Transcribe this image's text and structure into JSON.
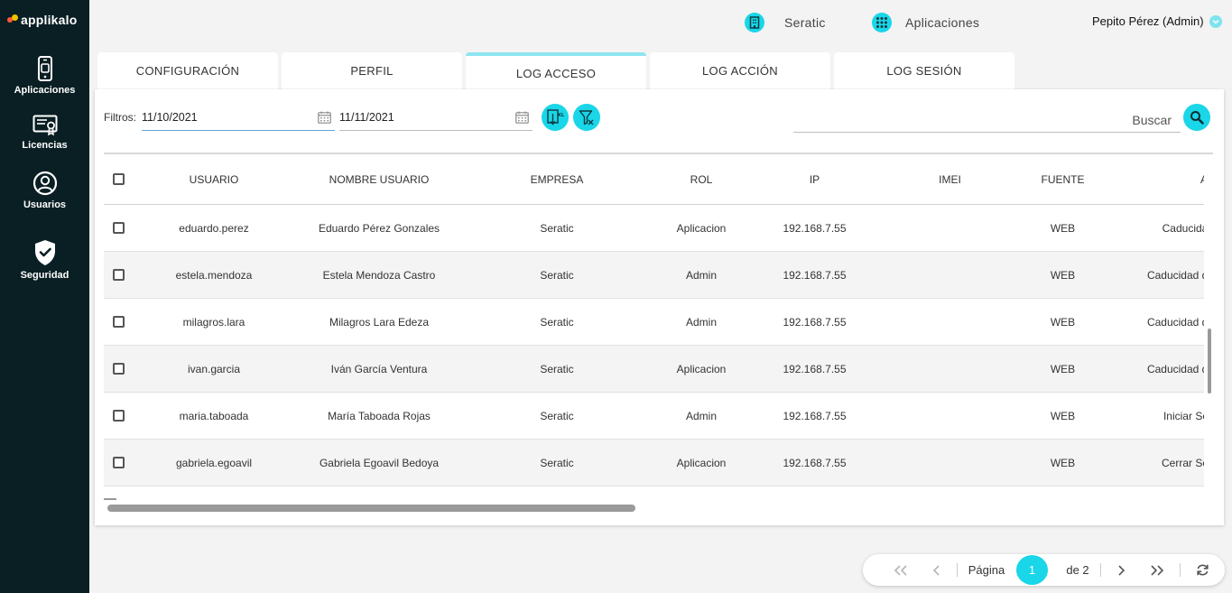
{
  "brand": {
    "name": "applikalo"
  },
  "sidebar": {
    "items": [
      {
        "label": "Aplicaciones",
        "icon": "smartphone-icon"
      },
      {
        "label": "Licencias",
        "icon": "certificate-icon"
      },
      {
        "label": "Usuarios",
        "icon": "user-circle-icon"
      },
      {
        "label": "Seguridad",
        "icon": "shield-check-icon"
      }
    ]
  },
  "topbar": {
    "company": "Seratic",
    "apps": "Aplicaciones",
    "user": "Pepito Pérez (Admin)"
  },
  "tabs": [
    {
      "label": "CONFIGURACIÓN",
      "active": false
    },
    {
      "label": "PERFIL",
      "active": false
    },
    {
      "label": "LOG ACCESO",
      "active": true
    },
    {
      "label": "LOG ACCIÓN",
      "active": false
    },
    {
      "label": "LOG SESIÓN",
      "active": false
    }
  ],
  "filters": {
    "label": "Filtros:",
    "date_from": "11/10/2021",
    "date_to": "11/11/2021",
    "search_placeholder": "Buscar"
  },
  "table": {
    "headers": [
      "USUARIO",
      "NOMBRE USUARIO",
      "EMPRESA",
      "ROL",
      "IP",
      "IMEI",
      "FUENTE",
      "AC"
    ],
    "rows": [
      {
        "usuario": "eduardo.perez",
        "nombre": "Eduardo Pérez Gonzales",
        "empresa": "Seratic",
        "rol": "Aplicacion",
        "ip": "192.168.7.55",
        "imei": "",
        "fuente": "WEB",
        "accion": "Caducidad"
      },
      {
        "usuario": "estela.mendoza",
        "nombre": "Estela Mendoza Castro",
        "empresa": "Seratic",
        "rol": "Admin",
        "ip": "192.168.7.55",
        "imei": "",
        "fuente": "WEB",
        "accion": "Caducidad de"
      },
      {
        "usuario": "milagros.lara",
        "nombre": "Milagros Lara Edeza",
        "empresa": "Seratic",
        "rol": "Admin",
        "ip": "192.168.7.55",
        "imei": "",
        "fuente": "WEB",
        "accion": "Caducidad de"
      },
      {
        "usuario": "ivan.garcia",
        "nombre": "Iván García Ventura",
        "empresa": "Seratic",
        "rol": "Aplicacion",
        "ip": "192.168.7.55",
        "imei": "",
        "fuente": "WEB",
        "accion": "Caducidad de"
      },
      {
        "usuario": "maria.taboada",
        "nombre": "María Taboada Rojas",
        "empresa": "Seratic",
        "rol": "Admin",
        "ip": "192.168.7.55",
        "imei": "",
        "fuente": "WEB",
        "accion": "Iniciar Ses"
      },
      {
        "usuario": "gabriela.egoavil",
        "nombre": "Gabriela Egoavil Bedoya",
        "empresa": "Seratic",
        "rol": "Aplicacion",
        "ip": "192.168.7.55",
        "imei": "",
        "fuente": "WEB",
        "accion": "Cerrar Ses"
      }
    ]
  },
  "pager": {
    "page_label": "Página",
    "current_page": "1",
    "total_label": "de 2"
  },
  "colors": {
    "accent": "#19d6e8",
    "sidebar_bg": "#0a1f24",
    "active_tab_border": "#8de6ef"
  }
}
